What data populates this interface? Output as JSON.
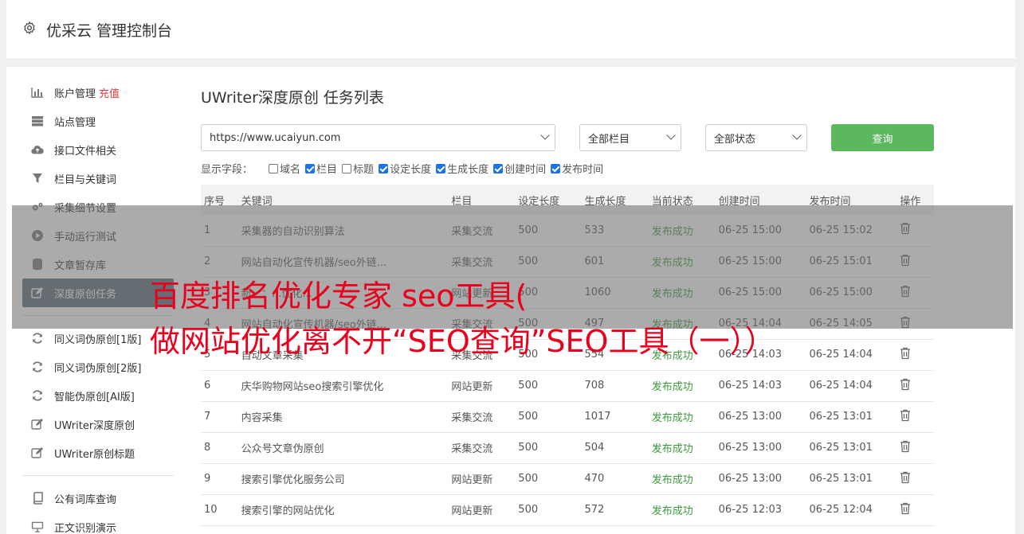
{
  "header": {
    "title": "优采云 管理控制台",
    "icon": "gear-icon"
  },
  "sidebar": {
    "items": [
      {
        "label": "账户管理",
        "extra": "充值",
        "icon": "bar-chart-icon"
      },
      {
        "label": "站点管理",
        "icon": "server-icon"
      },
      {
        "label": "接口文件相关",
        "icon": "cloud-upload-icon"
      },
      {
        "label": "栏目与关键词",
        "icon": "filter-icon"
      },
      {
        "label": "采集细节设置",
        "icon": "cogs-icon"
      },
      {
        "label": "手动运行测试",
        "icon": "play-icon"
      },
      {
        "label": "文章暂存库",
        "icon": "database-icon"
      },
      {
        "label": "深度原创任务",
        "icon": "edit-icon",
        "active": true
      },
      {
        "label": "同义词伪原创[1版]",
        "icon": "refresh-icon"
      },
      {
        "label": "同义词伪原创[2版]",
        "icon": "refresh-icon"
      },
      {
        "label": "智能伪原创[AI版]",
        "icon": "refresh-icon"
      },
      {
        "label": "UWriter深度原创",
        "icon": "edit-icon"
      },
      {
        "label": "UWriter原创标题",
        "icon": "edit-icon"
      },
      {
        "label": "公有词库查询",
        "icon": "book-icon"
      },
      {
        "label": "正文识别演示",
        "icon": "monitor-icon"
      }
    ]
  },
  "main": {
    "title": "UWriter深度原创 任务列表",
    "site_select": "https://www.ucaiyun.com",
    "column_select": "全部栏目",
    "status_select": "全部状态",
    "query_button": "查询",
    "fields_label": "显示字段：",
    "fields": [
      {
        "label": "域名",
        "checked": false
      },
      {
        "label": "栏目",
        "checked": true
      },
      {
        "label": "标题",
        "checked": false
      },
      {
        "label": "设定长度",
        "checked": true
      },
      {
        "label": "生成长度",
        "checked": true
      },
      {
        "label": "创建时间",
        "checked": true
      },
      {
        "label": "发布时间",
        "checked": true
      }
    ],
    "table": {
      "headers": [
        "序号",
        "关键词",
        "栏目",
        "设定长度",
        "生成长度",
        "当前状态",
        "创建时间",
        "发布时间",
        "操作"
      ],
      "rows": [
        [
          "1",
          "采集器的自动识别算法",
          "采集交流",
          "500",
          "533",
          "发布成功",
          "06-25 15:00",
          "06-25 15:02"
        ],
        [
          "2",
          "网站自动化宣传机器/seo外链...",
          "采集交流",
          "500",
          "601",
          "发布成功",
          "06-25 15:00",
          "06-25 15:01"
        ],
        [
          "3",
          "新...：...优化...",
          "网站更新",
          "500",
          "1060",
          "发布成功",
          "06-25 15:00",
          "06-25 15:00"
        ],
        [
          "4",
          "网站自动化宣传机器/seo外链...",
          "采集交流",
          "500",
          "497",
          "发布成功",
          "06-25 14:04",
          "06-25 14:05"
        ],
        [
          "5",
          "自动文章采集",
          "采集交流",
          "500",
          "554",
          "发布成功",
          "06-25 14:03",
          "06-25 14:04"
        ],
        [
          "6",
          "庆华购物网站seo搜索引擎优化",
          "网站更新",
          "500",
          "708",
          "发布成功",
          "06-25 14:03",
          "06-25 14:04"
        ],
        [
          "7",
          "内容采集",
          "采集交流",
          "500",
          "1017",
          "发布成功",
          "06-25 13:00",
          "06-25 13:01"
        ],
        [
          "8",
          "公众号文章伪原创",
          "采集交流",
          "500",
          "504",
          "发布成功",
          "06-25 13:00",
          "06-25 13:01"
        ],
        [
          "9",
          "搜索引擎优化服务公司",
          "网站更新",
          "500",
          "470",
          "发布成功",
          "06-25 13:00",
          "06-25 13:01"
        ],
        [
          "10",
          "搜索引擎的网站优化",
          "网站更新",
          "500",
          "572",
          "发布成功",
          "06-25 12:03",
          "06-25 12:04"
        ]
      ]
    }
  },
  "overlay": {
    "line1": "百度排名优化专家 seo工具(",
    "line2": "做网站优化离不开“SEO查询”SEO工具（一））"
  }
}
